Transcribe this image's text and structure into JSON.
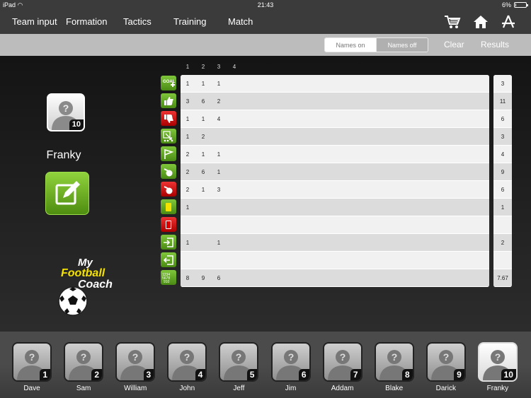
{
  "status": {
    "device": "iPad",
    "time": "21:43",
    "battery": "6%",
    "battery_fraction": 0.06
  },
  "nav": {
    "items": [
      "Team input",
      "Formation",
      "Tactics",
      "Training",
      "Match"
    ],
    "icons": [
      "cart-icon",
      "home-icon",
      "app-store-icon"
    ]
  },
  "toolbar": {
    "names_on": "Names on",
    "names_off": "Names off",
    "clear": "Clear",
    "results": "Results"
  },
  "player": {
    "name": "Franky",
    "number": "10"
  },
  "logo": {
    "line1": "My",
    "line2": "Football",
    "line3": "Coach"
  },
  "stats": {
    "columns": [
      "1",
      "2",
      "3",
      "4"
    ],
    "rows": [
      {
        "icon": "goal-icon",
        "values": [
          "1",
          "1",
          "1",
          ""
        ],
        "total": "3"
      },
      {
        "icon": "thumbs-up-icon",
        "values": [
          "3",
          "6",
          "2",
          ""
        ],
        "total": "11"
      },
      {
        "icon": "thumbs-down-icon",
        "values": [
          "1",
          "1",
          "4",
          ""
        ],
        "total": "6"
      },
      {
        "icon": "assist-icon",
        "values": [
          "1",
          "2",
          "",
          ""
        ],
        "total": "3"
      },
      {
        "icon": "corner-flag-icon",
        "values": [
          "2",
          "1",
          "1",
          ""
        ],
        "total": "4"
      },
      {
        "icon": "whistle-icon",
        "values": [
          "2",
          "6",
          "1",
          ""
        ],
        "total": "9"
      },
      {
        "icon": "whistle-red-icon",
        "values": [
          "2",
          "1",
          "3",
          ""
        ],
        "total": "6"
      },
      {
        "icon": "yellow-card-icon",
        "values": [
          "1",
          "",
          "",
          ""
        ],
        "total": "1"
      },
      {
        "icon": "red-card-icon",
        "values": [
          "",
          "",
          "",
          ""
        ],
        "total": ""
      },
      {
        "icon": "sub-in-icon",
        "values": [
          "1",
          "",
          "1",
          ""
        ],
        "total": "2"
      },
      {
        "icon": "sub-out-icon",
        "values": [
          "",
          "",
          "",
          ""
        ],
        "total": ""
      },
      {
        "icon": "rating-icon",
        "values": [
          "8",
          "9",
          "6",
          ""
        ],
        "total": "7.67"
      }
    ]
  },
  "roster": [
    {
      "name": "Dave",
      "number": "1"
    },
    {
      "name": "Sam",
      "number": "2"
    },
    {
      "name": "William",
      "number": "3"
    },
    {
      "name": "John",
      "number": "4"
    },
    {
      "name": "Jeff",
      "number": "5"
    },
    {
      "name": "Jim",
      "number": "6"
    },
    {
      "name": "Addam",
      "number": "7"
    },
    {
      "name": "Blake",
      "number": "8"
    },
    {
      "name": "Darick",
      "number": "9"
    },
    {
      "name": "Franky",
      "number": "10",
      "selected": true
    }
  ],
  "colors": {
    "green": "#5fa51f",
    "red": "#cc1111",
    "yellow": "#f5e200"
  }
}
